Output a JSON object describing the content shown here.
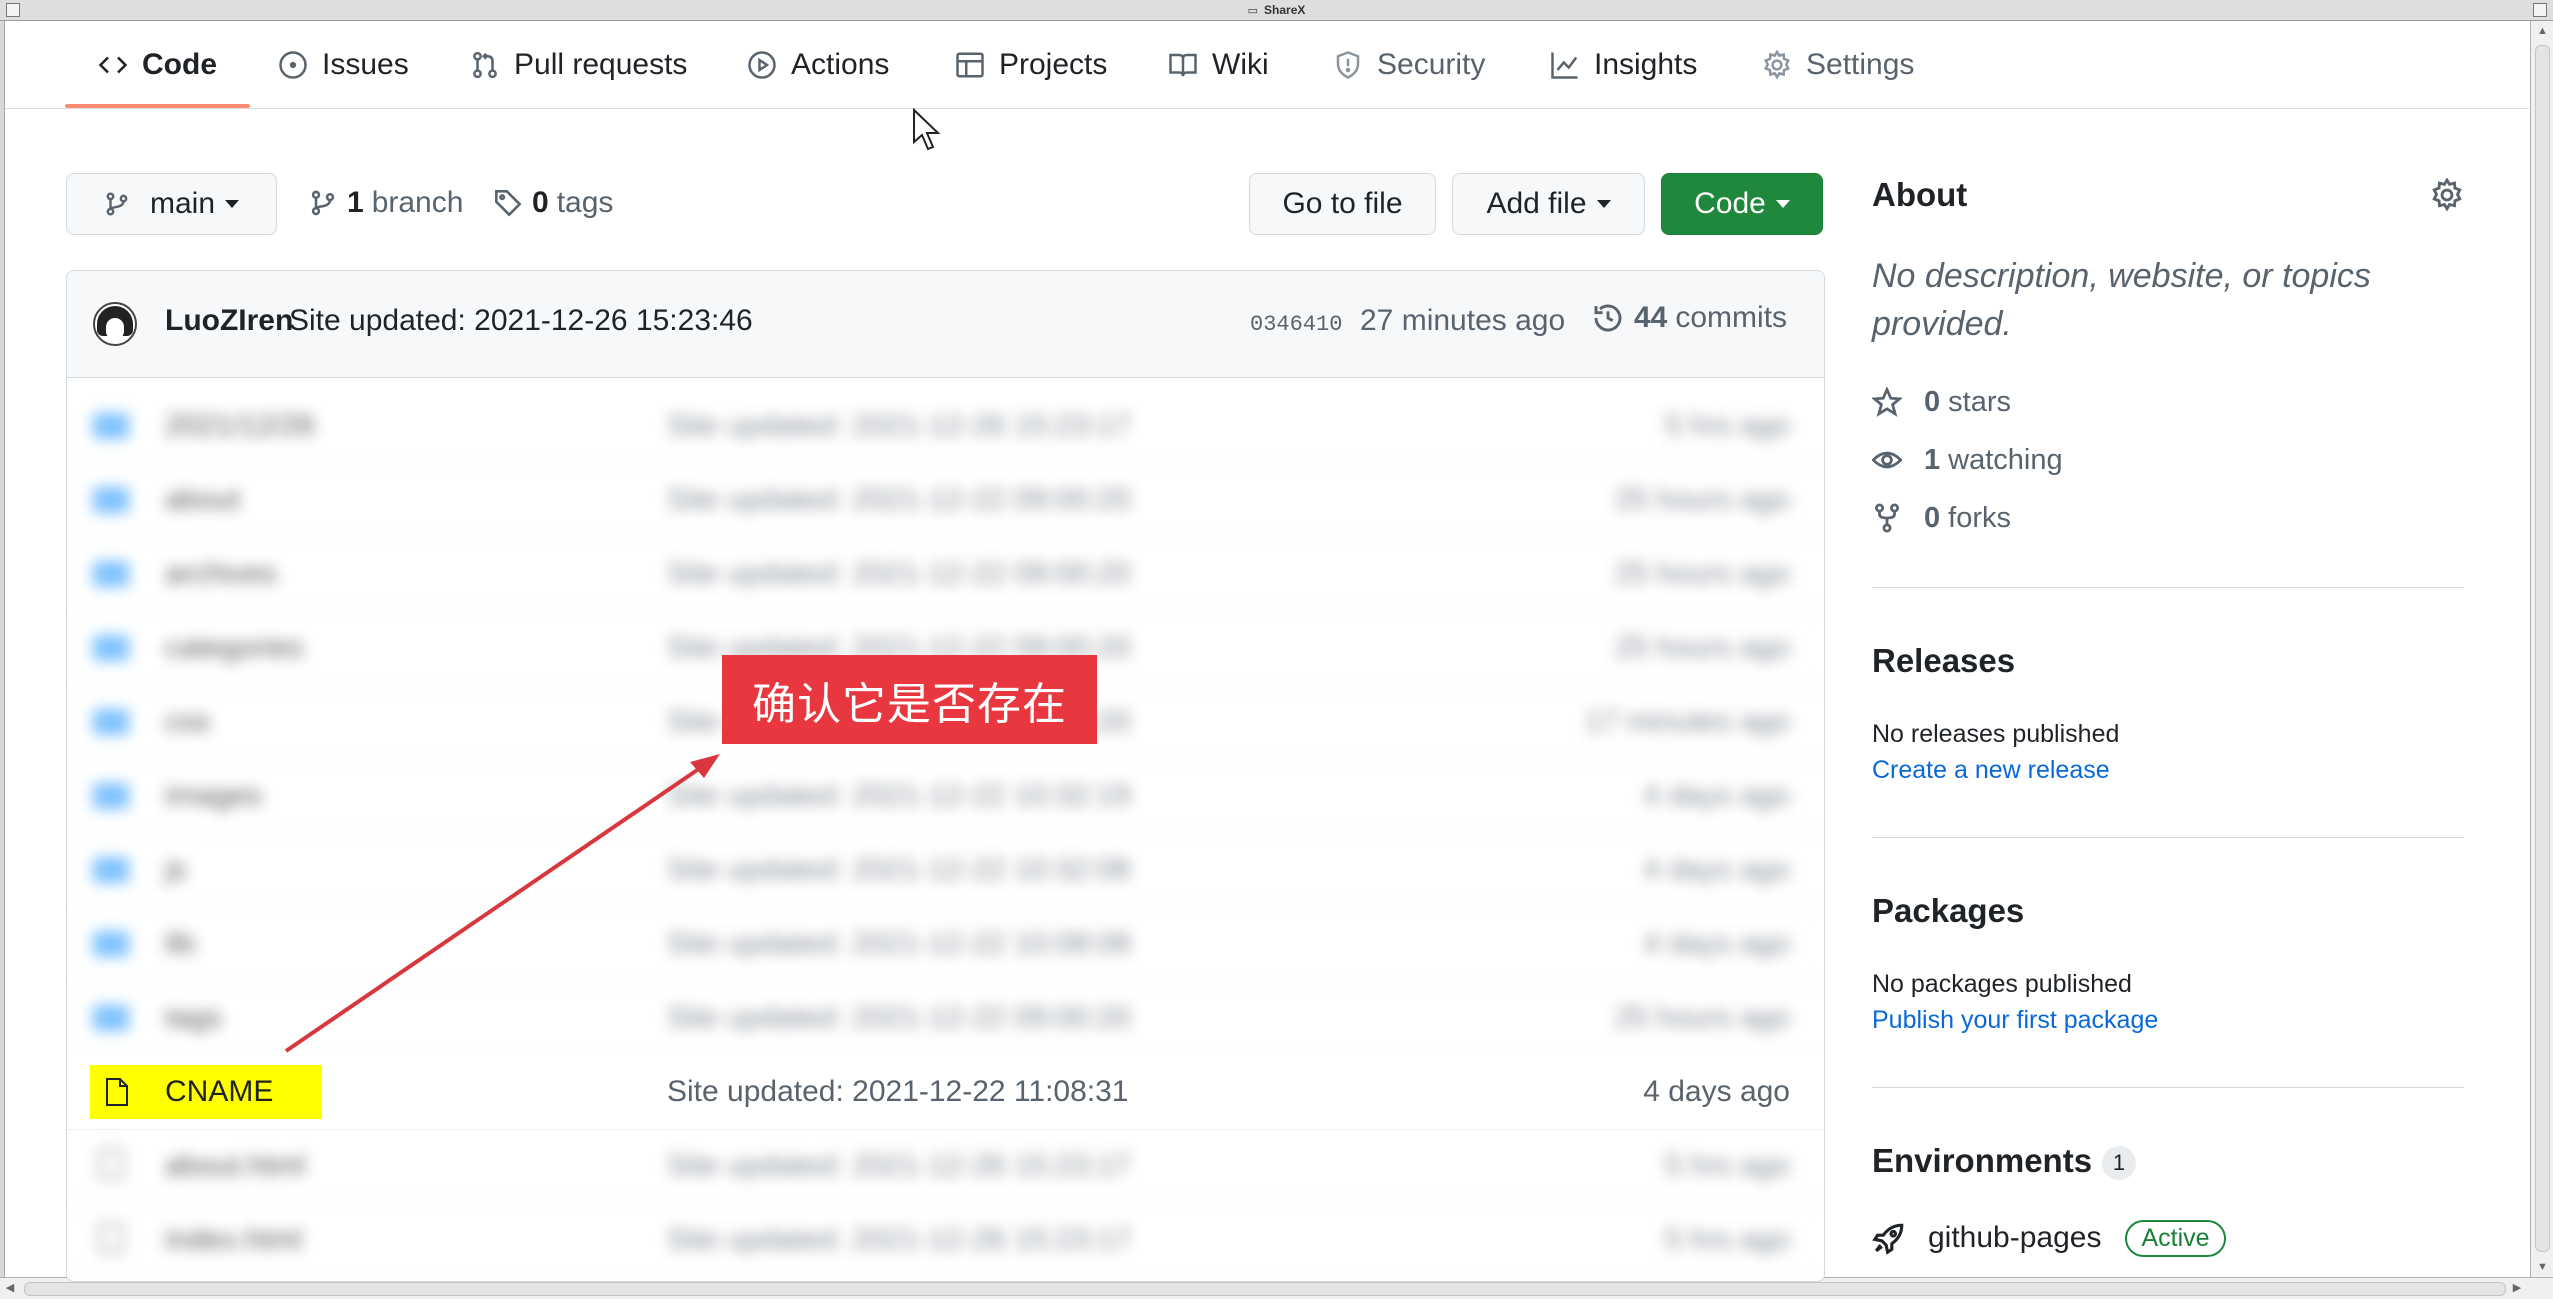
{
  "window": {
    "title": "ShareX"
  },
  "nav": {
    "tabs": [
      {
        "label": "Code",
        "icon": "code-icon"
      },
      {
        "label": "Issues",
        "icon": "issue-icon"
      },
      {
        "label": "Pull requests",
        "icon": "pull-request-icon"
      },
      {
        "label": "Actions",
        "icon": "play-icon"
      },
      {
        "label": "Projects",
        "icon": "table-icon"
      },
      {
        "label": "Wiki",
        "icon": "book-icon"
      },
      {
        "label": "Security",
        "icon": "shield-icon"
      },
      {
        "label": "Insights",
        "icon": "graph-icon"
      },
      {
        "label": "Settings",
        "icon": "gear-icon"
      }
    ],
    "active_tab": "Code"
  },
  "toolbar": {
    "branch_button": "main",
    "branch_count": "1",
    "branch_label": "branch",
    "tag_count": "0",
    "tag_label": "tags",
    "go_to_file": "Go to file",
    "add_file": "Add file",
    "code_button": "Code"
  },
  "commit": {
    "author": "LuoZIren",
    "message": "Site updated: 2021-12-26 15:23:46",
    "sha": "0346410",
    "time": "27 minutes ago",
    "count": "44",
    "count_label": "commits"
  },
  "files_blurred": [
    {
      "name": "2021/12/26",
      "message": "Site updated: 2021-12-26 15:23:17",
      "time": "5 hrs ago",
      "type": "folder"
    },
    {
      "name": "about",
      "message": "Site updated: 2021-12-22 09:00:20",
      "time": "25 hours ago",
      "type": "folder"
    },
    {
      "name": "archives",
      "message": "Site updated: 2021-12-22 09:00:20",
      "time": "25 hours ago",
      "type": "folder"
    },
    {
      "name": "categories",
      "message": "Site updated: 2021-12-22 09:00:20",
      "time": "25 hours ago",
      "type": "folder"
    },
    {
      "name": "css",
      "message": "Site updated: 2021-12-22 09:00:20",
      "time": "17 minutes ago",
      "type": "folder"
    },
    {
      "name": "images",
      "message": "Site updated: 2021-12-22 10:32:19",
      "time": "4 days ago",
      "type": "folder"
    },
    {
      "name": "js",
      "message": "Site updated: 2021-12-22 10:32:08",
      "time": "4 days ago",
      "type": "folder"
    },
    {
      "name": "lib",
      "message": "Site updated: 2021-12-22 10:08:08",
      "time": "4 days ago",
      "type": "folder"
    },
    {
      "name": "tags",
      "message": "Site updated: 2021-12-22 09:00:20",
      "time": "25 hours ago",
      "type": "folder"
    }
  ],
  "cname_row": {
    "name": "CNAME",
    "message": "Site updated: 2021-12-22 11:08:31",
    "time": "4 days ago"
  },
  "files_blurred_after": [
    {
      "name": "about.html",
      "message": "Site updated: 2021-12-26 15:23:17",
      "time": "5 hrs ago",
      "type": "file"
    },
    {
      "name": "index.html",
      "message": "Site updated: 2021-12-26 15:23:17",
      "time": "5 hrs ago",
      "type": "file"
    }
  ],
  "annotation": {
    "text": "确认它是否存在",
    "color": "#e8373f"
  },
  "sidebar": {
    "about_title": "About",
    "about_desc": "No description, website, or topics provided.",
    "stars_count": "0",
    "stars_label": "stars",
    "watching_count": "1",
    "watching_label": "watching",
    "forks_count": "0",
    "forks_label": "forks",
    "releases_title": "Releases",
    "releases_note": "No releases published",
    "releases_link": "Create a new release",
    "packages_title": "Packages",
    "packages_note": "No packages published",
    "packages_link": "Publish your first package",
    "environments_title": "Environments",
    "environments_count": "1",
    "env_name": "github-pages",
    "env_status": "Active"
  },
  "colors": {
    "accent_green": "#1f883d",
    "link_blue": "#0969da",
    "tab_underline": "#fd8c73",
    "highlight_yellow": "#ffff00"
  }
}
